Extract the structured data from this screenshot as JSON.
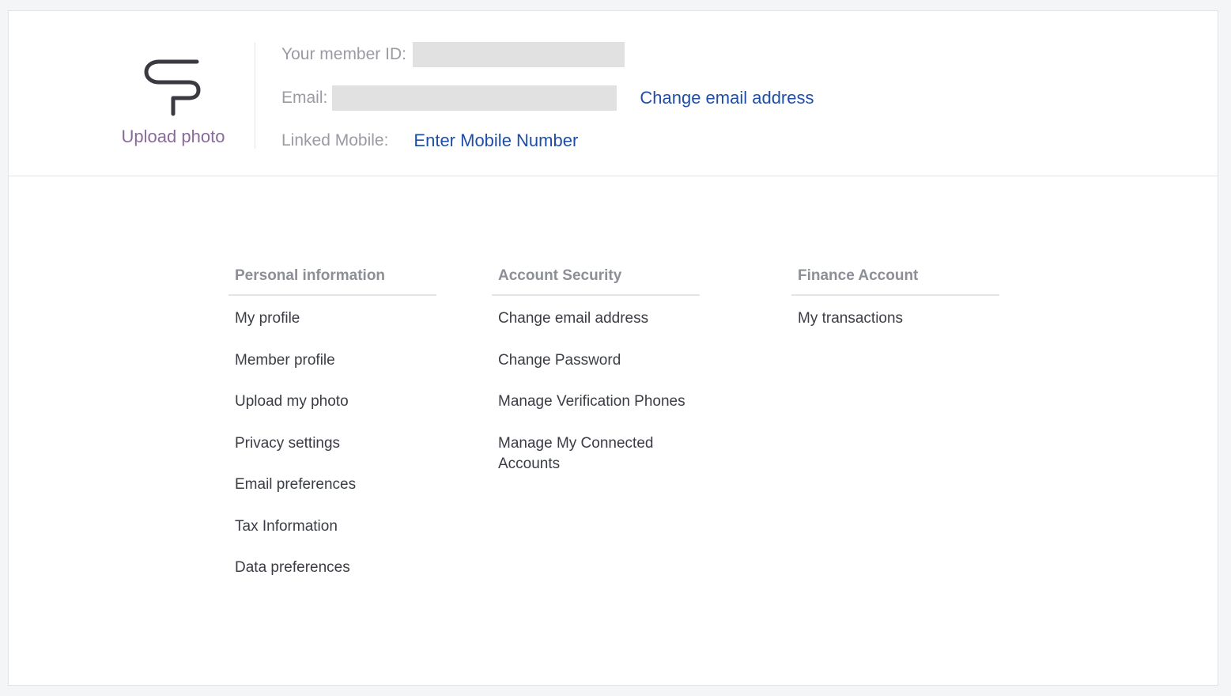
{
  "header": {
    "upload_photo_label": "Upload photo",
    "member_id_label": "Your member ID:",
    "email_label": "Email:",
    "change_email_label": "Change email address",
    "linked_mobile_label": "Linked Mobile:",
    "enter_mobile_label": "Enter Mobile Number"
  },
  "columns": {
    "personal": {
      "title": "Personal information",
      "items": [
        "My profile",
        "Member profile",
        "Upload my photo",
        "Privacy settings",
        "Email preferences",
        "Tax Information",
        "Data preferences"
      ]
    },
    "security": {
      "title": "Account Security",
      "items": [
        "Change email address",
        "Change Password",
        "Manage Verification Phones",
        "Manage My Connected Accounts"
      ]
    },
    "finance": {
      "title": "Finance Account",
      "items": [
        "My transactions"
      ]
    }
  },
  "colors": {
    "link": "#1f4ea8",
    "upload_link": "#8a6a9a",
    "masked_field": "#e1e1e1"
  }
}
